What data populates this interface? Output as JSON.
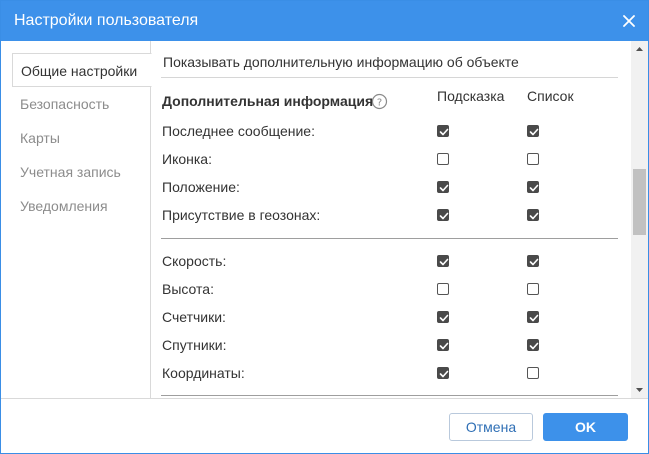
{
  "window": {
    "title": "Настройки пользователя",
    "close_icon": "close-icon"
  },
  "sidebar": {
    "items": [
      {
        "label": "Общие настройки",
        "active": true
      },
      {
        "label": "Безопасность",
        "active": false
      },
      {
        "label": "Карты",
        "active": false
      },
      {
        "label": "Учетная запись",
        "active": false
      },
      {
        "label": "Уведомления",
        "active": false
      }
    ]
  },
  "main": {
    "section_title": "Показывать дополнительную информацию об объекте",
    "subheader": "Дополнительная информация",
    "help_icon": "question-circle-icon",
    "columns": [
      "Подсказка",
      "Список"
    ],
    "groups": [
      {
        "rows": [
          {
            "label": "Последнее сообщение:",
            "tooltip": true,
            "list": true
          },
          {
            "label": "Иконка:",
            "tooltip": false,
            "list": false
          },
          {
            "label": "Положение:",
            "tooltip": true,
            "list": true
          },
          {
            "label": "Присутствие в геозонах:",
            "tooltip": true,
            "list": true
          }
        ]
      },
      {
        "rows": [
          {
            "label": "Скорость:",
            "tooltip": true,
            "list": true
          },
          {
            "label": "Высота:",
            "tooltip": false,
            "list": false
          },
          {
            "label": "Счетчики:",
            "tooltip": true,
            "list": true
          },
          {
            "label": "Спутники:",
            "tooltip": true,
            "list": true
          },
          {
            "label": "Координаты:",
            "tooltip": true,
            "list": false
          }
        ]
      }
    ]
  },
  "footer": {
    "cancel_label": "Отмена",
    "ok_label": "OK"
  },
  "colors": {
    "accent": "#3d91ea",
    "checkbox_checked": "#4a4a4a",
    "sidebar_inactive_text": "#8c8c8c"
  }
}
